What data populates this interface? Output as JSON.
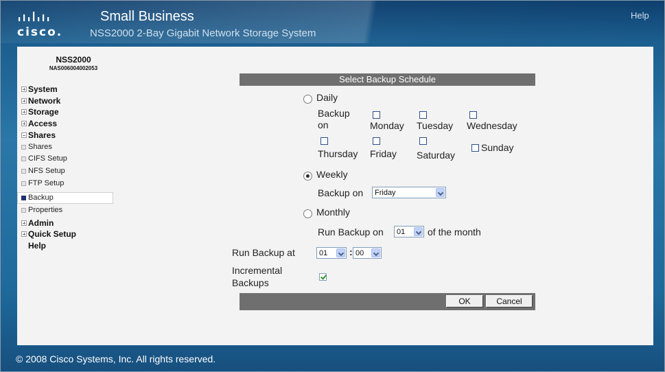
{
  "header": {
    "logo_text": "cisco.",
    "brand_title": "Small Business",
    "brand_subtitle": "NSS2000 2-Bay Gigabit Network Storage System",
    "help_label": "Help"
  },
  "sidebar": {
    "device_name": "NSS2000",
    "device_id": "NAS006004002053",
    "items": [
      {
        "label": "System"
      },
      {
        "label": "Network"
      },
      {
        "label": "Storage"
      },
      {
        "label": "Access"
      },
      {
        "label": "Shares"
      },
      {
        "label": "Admin"
      },
      {
        "label": "Quick Setup"
      },
      {
        "label": "Help"
      }
    ],
    "shares_subitems": [
      {
        "label": "Shares"
      },
      {
        "label": "CIFS Setup"
      },
      {
        "label": "NFS Setup"
      },
      {
        "label": "FTP Setup"
      },
      {
        "label": "Backup"
      },
      {
        "label": "Properties"
      }
    ]
  },
  "form": {
    "title": "Select Backup Schedule",
    "daily": {
      "label": "Daily",
      "selected": false,
      "backup_on_label": "Backup on",
      "days": [
        {
          "label": "Monday",
          "checked": false
        },
        {
          "label": "Tuesday",
          "checked": false
        },
        {
          "label": "Wednesday",
          "checked": false
        },
        {
          "label": "Thursday",
          "checked": false
        },
        {
          "label": "Friday",
          "checked": false
        },
        {
          "label": "Saturday",
          "checked": false
        },
        {
          "label": "Sunday",
          "checked": false
        }
      ]
    },
    "weekly": {
      "label": "Weekly",
      "selected": true,
      "backup_on_label": "Backup on",
      "day_value": "Friday"
    },
    "monthly": {
      "label": "Monthly",
      "selected": false,
      "run_label": "Run Backup on",
      "day_value": "01",
      "suffix": "of the month"
    },
    "run_at": {
      "label": "Run Backup at",
      "hour": "01",
      "separator": ":",
      "minute": "00"
    },
    "incremental": {
      "label_line1": "Incremental",
      "label_line2": "Backups",
      "checked": true
    },
    "buttons": {
      "ok": "OK",
      "cancel": "Cancel"
    }
  },
  "footer": {
    "copyright": "© 2008 Cisco Systems, Inc. All rights reserved."
  },
  "colors": {
    "header_blue": "#0e3f6e",
    "panel_gray": "#f3f3f3",
    "bar_gray": "#6f6f6f",
    "active_marker": "#203070"
  }
}
